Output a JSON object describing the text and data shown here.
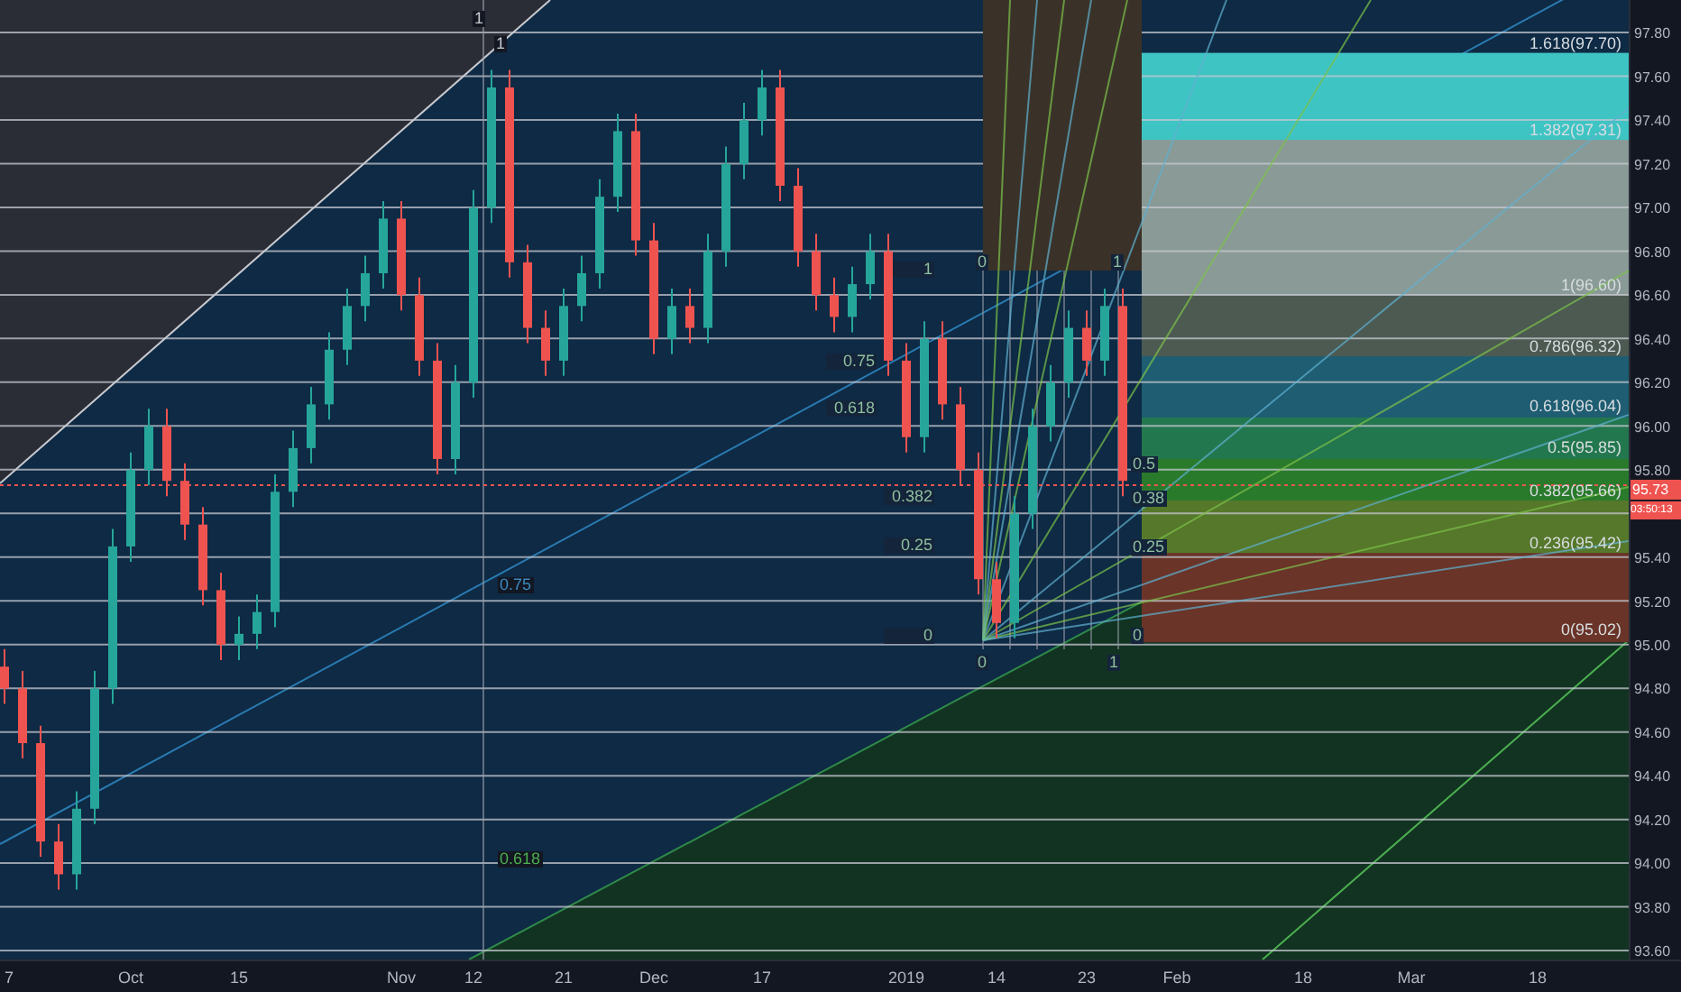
{
  "current_price": {
    "value": "95.73",
    "countdown": "03:50:13"
  },
  "chart_data": {
    "type": "candlestick",
    "ylim": [
      93.56,
      97.95
    ],
    "grid": true,
    "yticks": [
      {
        "value": 97.8,
        "label": "97.80"
      },
      {
        "value": 97.6,
        "label": "97.60"
      },
      {
        "value": 97.4,
        "label": "97.40"
      },
      {
        "value": 97.2,
        "label": "97.20"
      },
      {
        "value": 97.0,
        "label": "97.00"
      },
      {
        "value": 96.8,
        "label": "96.80"
      },
      {
        "value": 96.6,
        "label": "96.60"
      },
      {
        "value": 96.4,
        "label": "96.40"
      },
      {
        "value": 96.2,
        "label": "96.20"
      },
      {
        "value": 96.0,
        "label": "96.00"
      },
      {
        "value": 95.8,
        "label": "95.80"
      },
      {
        "value": 95.4,
        "label": "95.40"
      },
      {
        "value": 95.2,
        "label": "95.20"
      },
      {
        "value": 95.0,
        "label": "95.00"
      },
      {
        "value": 94.8,
        "label": "94.80"
      },
      {
        "value": 94.6,
        "label": "94.60"
      },
      {
        "value": 94.4,
        "label": "94.40"
      },
      {
        "value": 94.2,
        "label": "94.20"
      },
      {
        "value": 94.0,
        "label": "94.00"
      },
      {
        "value": 93.8,
        "label": "93.80"
      },
      {
        "value": 93.6,
        "label": "93.60"
      }
    ],
    "categories": [
      "7",
      null,
      null,
      null,
      null,
      null,
      null,
      "Oct",
      null,
      null,
      null,
      null,
      null,
      "15",
      null,
      null,
      null,
      null,
      null,
      null,
      null,
      null,
      "Nov",
      null,
      null,
      null,
      "12",
      null,
      null,
      null,
      null,
      "21",
      null,
      null,
      null,
      null,
      "Dec",
      null,
      null,
      null,
      null,
      null,
      "17",
      null,
      null,
      null,
      null,
      null,
      null,
      null,
      "2019",
      null,
      null,
      null,
      null,
      "14",
      null,
      null,
      null,
      null,
      "23",
      null,
      null,
      null,
      null,
      "Feb",
      null,
      null,
      null,
      null,
      null,
      null,
      "18",
      null,
      null,
      null,
      null,
      null,
      "Mar",
      null,
      null,
      null,
      null,
      null,
      null,
      "18",
      null,
      null,
      null,
      null,
      null
    ],
    "ohlc": [
      [
        94.9,
        94.98,
        94.73,
        94.8
      ],
      [
        94.8,
        94.88,
        94.48,
        94.55
      ],
      [
        94.55,
        94.63,
        94.03,
        94.1
      ],
      [
        94.1,
        94.18,
        93.88,
        93.95
      ],
      [
        93.95,
        94.33,
        93.88,
        94.25
      ],
      [
        94.25,
        94.88,
        94.18,
        94.8
      ],
      [
        94.8,
        95.53,
        94.73,
        95.45
      ],
      [
        95.45,
        95.88,
        95.38,
        95.8
      ],
      [
        95.8,
        96.08,
        95.73,
        96.0
      ],
      [
        96.0,
        96.08,
        95.68,
        95.75
      ],
      [
        95.75,
        95.83,
        95.48,
        95.55
      ],
      [
        95.55,
        95.63,
        95.18,
        95.25
      ],
      [
        95.25,
        95.33,
        94.93,
        95.0
      ],
      [
        95.0,
        95.13,
        94.93,
        95.05
      ],
      [
        95.05,
        95.23,
        94.98,
        95.15
      ],
      [
        95.15,
        95.78,
        95.08,
        95.7
      ],
      [
        95.7,
        95.98,
        95.63,
        95.9
      ],
      [
        95.9,
        96.18,
        95.83,
        96.1
      ],
      [
        96.1,
        96.43,
        96.03,
        96.35
      ],
      [
        96.35,
        96.63,
        96.28,
        96.55
      ],
      [
        96.55,
        96.78,
        96.48,
        96.7
      ],
      [
        96.7,
        97.03,
        96.63,
        96.95
      ],
      [
        96.95,
        97.03,
        96.53,
        96.6
      ],
      [
        96.6,
        96.68,
        96.23,
        96.3
      ],
      [
        96.3,
        96.38,
        95.78,
        95.85
      ],
      [
        95.85,
        96.28,
        95.78,
        96.2
      ],
      [
        96.2,
        97.08,
        96.13,
        97.0
      ],
      [
        97.0,
        97.63,
        96.93,
        97.55
      ],
      [
        97.55,
        97.63,
        96.68,
        96.75
      ],
      [
        96.75,
        96.83,
        96.38,
        96.45
      ],
      [
        96.45,
        96.53,
        96.23,
        96.3
      ],
      [
        96.3,
        96.63,
        96.23,
        96.55
      ],
      [
        96.55,
        96.78,
        96.48,
        96.7
      ],
      [
        96.7,
        97.13,
        96.63,
        97.05
      ],
      [
        97.05,
        97.43,
        96.98,
        97.35
      ],
      [
        97.35,
        97.43,
        96.78,
        96.85
      ],
      [
        96.85,
        96.93,
        96.33,
        96.4
      ],
      [
        96.4,
        96.63,
        96.33,
        96.55
      ],
      [
        96.55,
        96.63,
        96.38,
        96.45
      ],
      [
        96.45,
        96.88,
        96.38,
        96.8
      ],
      [
        96.8,
        97.28,
        96.73,
        97.2
      ],
      [
        97.2,
        97.48,
        97.13,
        97.4
      ],
      [
        97.4,
        97.63,
        97.33,
        97.55
      ],
      [
        97.55,
        97.63,
        97.03,
        97.1
      ],
      [
        97.1,
        97.18,
        96.73,
        96.8
      ],
      [
        96.8,
        96.88,
        96.53,
        96.6
      ],
      [
        96.6,
        96.68,
        96.43,
        96.5
      ],
      [
        96.5,
        96.73,
        96.43,
        96.65
      ],
      [
        96.65,
        96.88,
        96.58,
        96.8
      ],
      [
        96.8,
        96.88,
        96.23,
        96.3
      ],
      [
        96.3,
        96.38,
        95.88,
        95.95
      ],
      [
        95.95,
        96.48,
        95.88,
        96.4
      ],
      [
        96.4,
        96.48,
        96.03,
        96.1
      ],
      [
        96.1,
        96.18,
        95.73,
        95.8
      ],
      [
        95.8,
        95.88,
        95.23,
        95.3
      ],
      [
        95.3,
        95.38,
        95.03,
        95.1
      ],
      [
        95.1,
        95.68,
        95.03,
        95.6
      ],
      [
        95.6,
        96.08,
        95.53,
        96.0
      ],
      [
        96.0,
        96.28,
        95.93,
        96.2
      ],
      [
        96.2,
        96.53,
        96.13,
        96.45
      ],
      [
        96.45,
        96.53,
        96.23,
        96.3
      ],
      [
        96.3,
        96.63,
        96.23,
        96.55
      ],
      [
        96.55,
        96.63,
        95.68,
        95.75
      ],
      null,
      null,
      null,
      null,
      null,
      null,
      null,
      null,
      null,
      null,
      null,
      null,
      null,
      null,
      null,
      null,
      null,
      null,
      null,
      null,
      null,
      null,
      null,
      null,
      null,
      null,
      null,
      null
    ]
  },
  "fib_retracement": {
    "levels": [
      {
        "label": "1.618(97.70)",
        "color": "#3fc4c4"
      },
      {
        "label": "1.382(97.31)",
        "color": "#3fc4c4"
      },
      {
        "label": "1(96.60)",
        "color": "#8a9a96"
      },
      {
        "label": "0.786(96.32)",
        "color": "#4c5a52"
      },
      {
        "label": "0.618(96.04)",
        "color": "#1e5d72"
      },
      {
        "label": "0.5(95.85)",
        "color": "#23774e"
      },
      {
        "label": "0.382(95.66)",
        "color": "#2a7a2c"
      },
      {
        "label": "0.236(95.42)",
        "color": "#56782a"
      },
      {
        "label": "0(95.02)",
        "color": "#6a3428"
      }
    ]
  },
  "gann_box": {
    "top_labels": [
      "0",
      "1"
    ],
    "left_labels": [
      "1",
      "0.75",
      "0.618",
      "0.382",
      "0.25",
      "0"
    ],
    "right_labels": [
      "0.5",
      "0.38",
      "0.25",
      "0"
    ],
    "bottom_labels": [
      "0",
      "1"
    ]
  },
  "channel": {
    "labels": [
      "1",
      "1",
      "0.75",
      "0.618"
    ]
  }
}
